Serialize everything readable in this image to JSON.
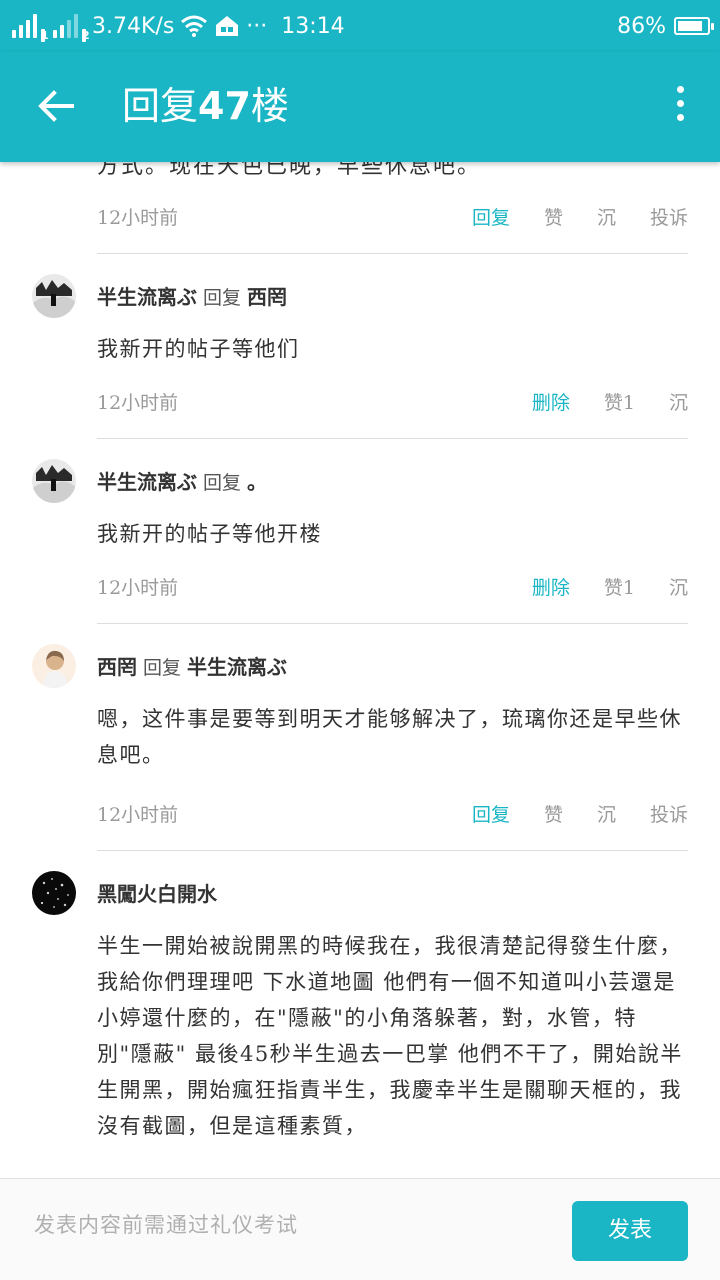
{
  "status_bar": {
    "sim1": "1",
    "sim2": "2",
    "speed": "3.74K/s",
    "dots": "···",
    "time": "13:14",
    "battery": "86%",
    "battery_level": 0.86
  },
  "app_bar": {
    "title_prefix": "回复",
    "title_number": "47",
    "title_suffix": "楼"
  },
  "top_partial": {
    "text": "方式。现在天色已晚，早些休息吧。",
    "time": "12小时前",
    "actions": [
      "回复",
      "赞",
      "沉",
      "投诉"
    ]
  },
  "comments": [
    {
      "author": "半生流离ぶ",
      "reply_word": "回复",
      "target": "西罔",
      "body": "我新开的帖子等他们",
      "time": "12小时前",
      "actions": [
        "删除",
        "赞1",
        "沉"
      ]
    },
    {
      "author": "半生流离ぶ",
      "reply_word": "回复",
      "target": "。",
      "body": "我新开的帖子等他开楼",
      "time": "12小时前",
      "actions": [
        "删除",
        "赞1",
        "沉"
      ]
    },
    {
      "author": "西罔",
      "reply_word": "回复",
      "target": "半生流离ぶ",
      "body": "嗯，这件事是要等到明天才能够解决了，琉璃你还是早些休息吧。",
      "time": "12小时前",
      "actions": [
        "回复",
        "赞",
        "沉",
        "投诉"
      ]
    },
    {
      "author": "黑闖火白開水",
      "body": "半生一開始被說開黑的時候我在，我很清楚記得發生什麼，我給你們理理吧 下水道地圖 他們有一個不知道叫小芸還是小婷還什麼的，在\"隱蔽\"的小角落躲著，對，水管，特別\"隱蔽\" 最後45秒半生過去一巴掌 他們不干了，開始說半生開黑，開始瘋狂指責半生，我慶幸半生是關聊天框的，我沒有截圖，但是這種素質，"
    }
  ],
  "bottom_bar": {
    "placeholder": "发表内容前需通过礼仪考试",
    "send_label": "发表"
  }
}
